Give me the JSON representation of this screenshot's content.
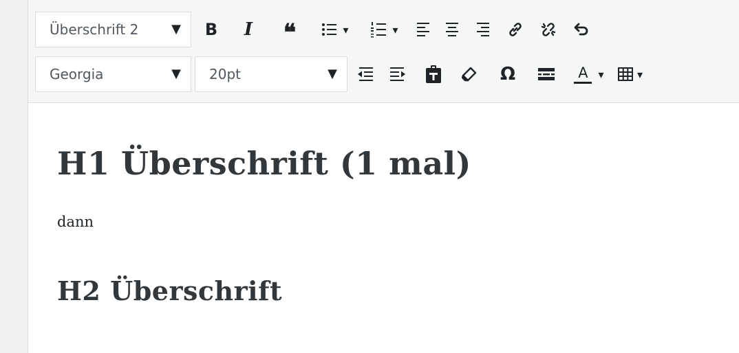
{
  "toolbar": {
    "row1": {
      "format_select": {
        "value": "Überschrift 2",
        "caret": "▼"
      },
      "buttons": [
        {
          "name": "bold",
          "label": "B"
        },
        {
          "name": "italic",
          "label": "I"
        },
        {
          "name": "blockquote",
          "label": "❝"
        },
        {
          "name": "bullet-list"
        },
        {
          "name": "numbered-list"
        },
        {
          "name": "align-left"
        },
        {
          "name": "align-center"
        },
        {
          "name": "align-right"
        },
        {
          "name": "insert-link"
        },
        {
          "name": "remove-link"
        },
        {
          "name": "undo"
        }
      ]
    },
    "row2": {
      "font_select": {
        "value": "Georgia",
        "caret": "▼"
      },
      "size_select": {
        "value": "20pt",
        "caret": "▼"
      },
      "buttons": [
        {
          "name": "outdent"
        },
        {
          "name": "indent"
        },
        {
          "name": "paste-as-text"
        },
        {
          "name": "clear-formatting"
        },
        {
          "name": "special-character",
          "label": "Ω"
        },
        {
          "name": "read-more"
        },
        {
          "name": "text-color",
          "label": "A"
        },
        {
          "name": "table"
        }
      ]
    },
    "dropdown_caret": "▾"
  },
  "content": {
    "heading1": "H1 Überschrift (1 mal)",
    "paragraph": "dann",
    "heading2": "H2 Überschrift"
  },
  "colors": {
    "icon": "#1d2327",
    "toolbar_bg": "#f6f7f7",
    "border": "#dcdcde",
    "heading_text": "#32373c"
  }
}
